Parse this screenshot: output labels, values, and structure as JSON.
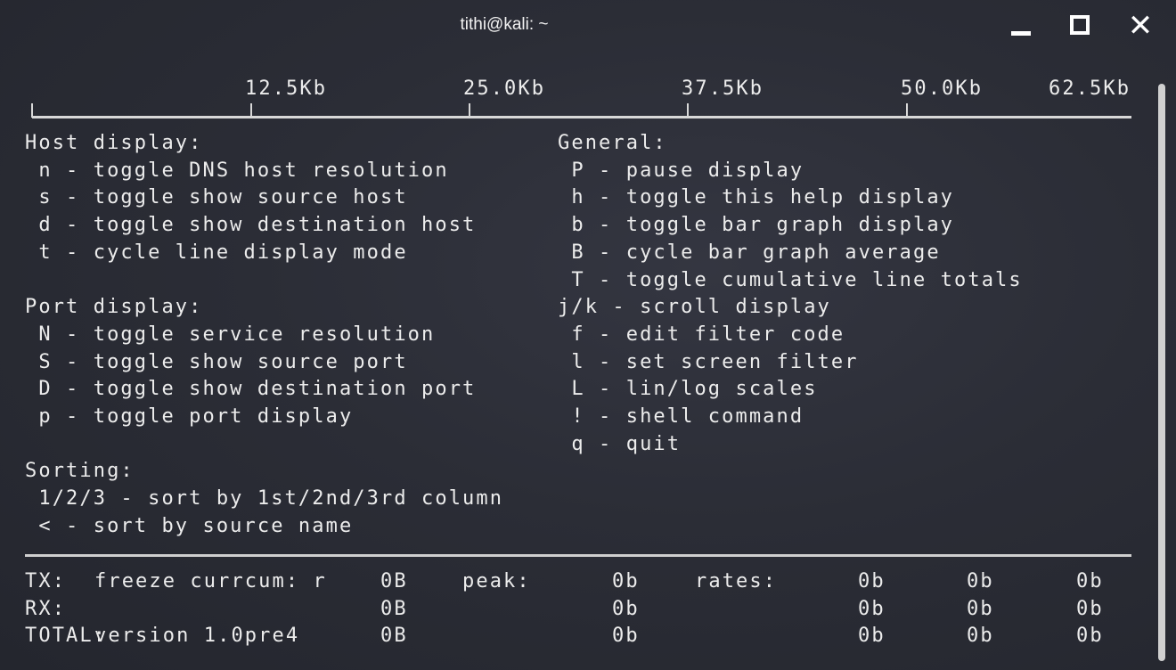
{
  "window": {
    "title": "tithi@kali: ~",
    "minimize_icon": "minimize-icon",
    "maximize_icon": "maximize-icon",
    "close_icon": "close-icon",
    "close_glyph": "✕"
  },
  "scale": {
    "labels": [
      "12.5Kb",
      "25.0Kb",
      "37.5Kb",
      "50.0Kb",
      "62.5Kb"
    ]
  },
  "help": {
    "left": [
      {
        "text": "Host display:",
        "heading": true
      },
      {
        "text": " n - toggle DNS host resolution"
      },
      {
        "text": " s - toggle show source host"
      },
      {
        "text": " d - toggle show destination host"
      },
      {
        "text": " t - cycle line display mode"
      },
      {
        "text": ""
      },
      {
        "text": "Port display:",
        "heading": true
      },
      {
        "text": " N - toggle service resolution"
      },
      {
        "text": " S - toggle show source port"
      },
      {
        "text": " D - toggle show destination port"
      },
      {
        "text": " p - toggle port display"
      },
      {
        "text": ""
      },
      {
        "text": "Sorting:",
        "heading": true
      },
      {
        "text": " 1/2/3 - sort by 1st/2nd/3rd column"
      },
      {
        "text": " < - sort by source name"
      }
    ],
    "right": [
      {
        "text": "General:",
        "heading": true
      },
      {
        "text": " P - pause display"
      },
      {
        "text": " h - toggle this help display"
      },
      {
        "text": " b - toggle bar graph display"
      },
      {
        "text": " B - cycle bar graph average"
      },
      {
        "text": " T - toggle cumulative line totals"
      },
      {
        "text": "j/k - scroll display"
      },
      {
        "text": " f - edit filter code"
      },
      {
        "text": " l - set screen filter"
      },
      {
        "text": " L - lin/log scales"
      },
      {
        "text": " ! - shell command"
      },
      {
        "text": " q - quit"
      }
    ]
  },
  "totals": {
    "rows": [
      {
        "label": "TX:",
        "info": "freeze currcum: r",
        "cum": "0B",
        "peak_label": "peak:",
        "peak": "0b",
        "rates_label": "rates:",
        "rates": [
          "0b",
          "0b",
          "0b"
        ]
      },
      {
        "label": "RX:",
        "info": "",
        "cum": "0B",
        "peak_label": "",
        "peak": "0b",
        "rates_label": "",
        "rates": [
          "0b",
          "0b",
          "0b"
        ]
      },
      {
        "label": "TOTAL:",
        "info": "version 1.0pre4",
        "cum": "0B",
        "peak_label": "",
        "peak": "0b",
        "rates_label": "",
        "rates": [
          "0b",
          "0b",
          "0b"
        ]
      }
    ]
  }
}
